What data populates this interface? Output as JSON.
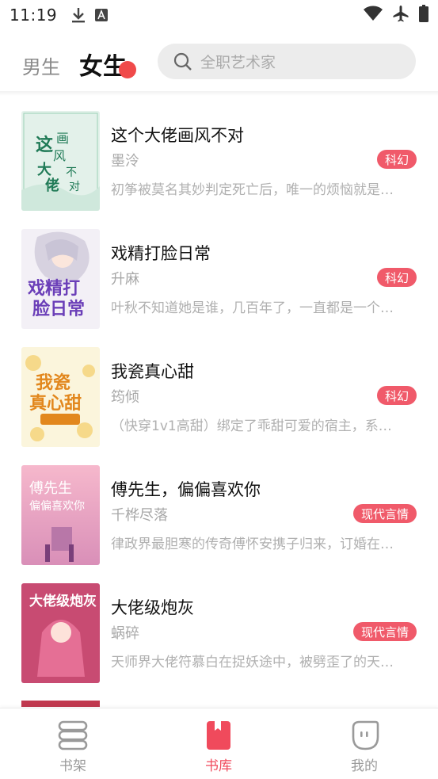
{
  "status_bar": {
    "time": "11:19"
  },
  "header": {
    "tabs": [
      {
        "label": "男生",
        "active": false
      },
      {
        "label": "女生",
        "active": true
      }
    ],
    "search": {
      "placeholder": "全职艺术家"
    }
  },
  "books": [
    {
      "title": "这个大佬画风不对",
      "author": "墨泠",
      "tag": "科幻",
      "desc": "初筝被莫名其妙判定死亡后，唯一的烦恼就是…"
    },
    {
      "title": "戏精打脸日常",
      "author": "升麻",
      "tag": "科幻",
      "desc": "叶秋不知道她是谁，几百年了，一直都是一个…"
    },
    {
      "title": "我瓷真心甜",
      "author": "筠倾",
      "tag": "科幻",
      "desc": "（快穿1v1高甜）绑定了乖甜可爱的宿主，系…"
    },
    {
      "title": "傅先生，偏偏喜欢你",
      "author": "千桦尽落",
      "tag": "现代言情",
      "desc": "律政界最胆寒的传奇傅怀安携子归来，订婚在…"
    },
    {
      "title": "大佬级炮灰",
      "author": "蜗碎",
      "tag": "现代言情",
      "desc": "天师界大佬符慕白在捉妖途中，被劈歪了的天…"
    }
  ],
  "covers": [
    {
      "text": "这个大佬画风不对",
      "bg": "#e6f3ec",
      "accent": "#1f7a56"
    },
    {
      "text": "戏精打脸日常",
      "bg": "#f1ecf6",
      "accent": "#6b3fb8"
    },
    {
      "text": "我瓷真心甜",
      "bg": "#fbf3d6",
      "accent": "#e08a1e"
    },
    {
      "text": "傅先生偏偏喜欢你",
      "bg": "#f3c6d8",
      "accent": "#ffffff"
    },
    {
      "text": "大佬级炮灰",
      "bg": "#c94b73",
      "accent": "#ffffff"
    }
  ],
  "bottom_nav": [
    {
      "label": "书架",
      "icon": "bookshelf-icon",
      "active": false
    },
    {
      "label": "书库",
      "icon": "library-icon",
      "active": true
    },
    {
      "label": "我的",
      "icon": "profile-icon",
      "active": false
    }
  ],
  "colors": {
    "accent": "#f04a5c",
    "tag_bg": "#f05a6a",
    "muted_text": "#a8a8a8"
  }
}
